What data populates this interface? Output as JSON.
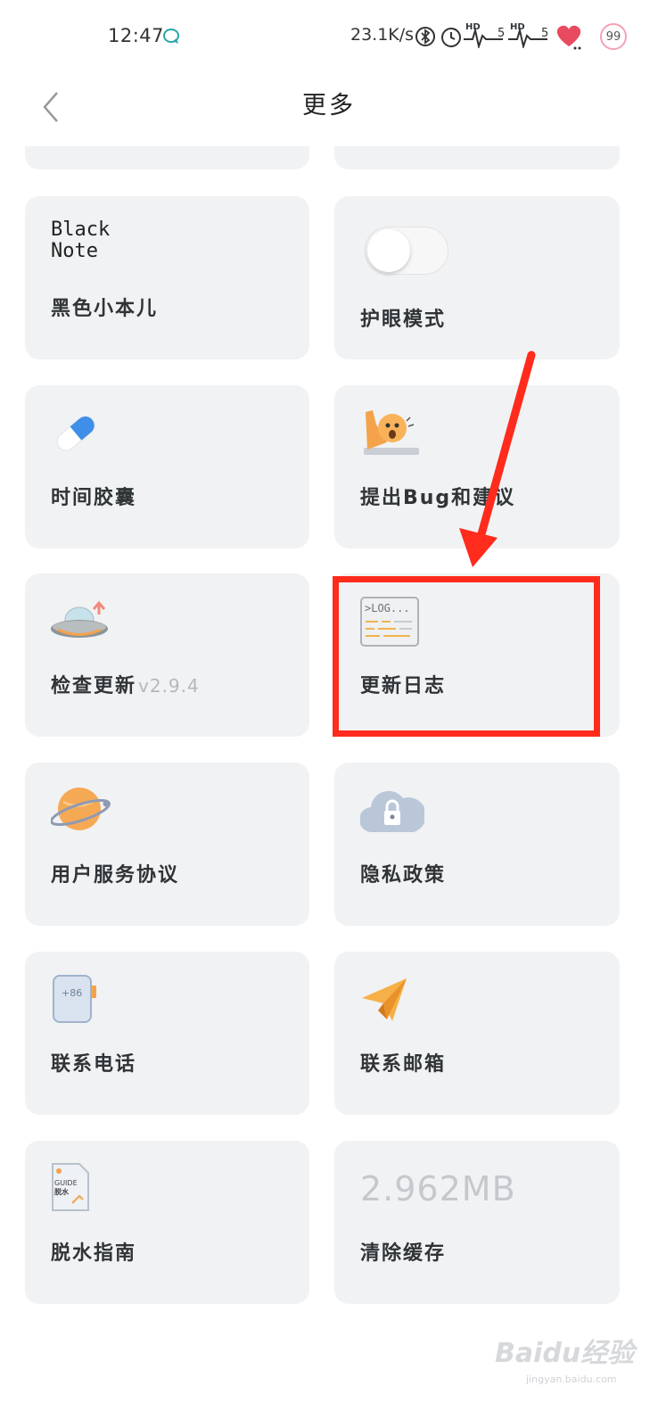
{
  "status_bar": {
    "time": "12:47",
    "net_speed": "23.1K/s",
    "battery": "99",
    "signal_label_1": "HD",
    "signal_label_2": "5",
    "signal_label_3": "HD",
    "signal_label_4": "5"
  },
  "header": {
    "title": "更多"
  },
  "cards": {
    "black_note": {
      "label": "黑色小本儿",
      "logo_text_1": "Black",
      "logo_text_2": "Note"
    },
    "eye_mode": {
      "label": "护眼模式",
      "toggle_on": false
    },
    "time_capsule": {
      "label": "时间胶囊"
    },
    "feedback": {
      "label": "提出Bug和建议"
    },
    "check_update": {
      "label": "检查更新",
      "version": "v2.9.4"
    },
    "changelog": {
      "label": "更新日志",
      "icon_text": ">LOG..."
    },
    "user_agreement": {
      "label": "用户服务协议"
    },
    "privacy": {
      "label": "隐私政策"
    },
    "phone": {
      "label": "联系电话",
      "icon_text": "+86"
    },
    "email": {
      "label": "联系邮箱"
    },
    "guide": {
      "label": "脱水指南",
      "icon_text_1": "GUIDE",
      "icon_text_2": "脱水"
    },
    "cache": {
      "label": "清除缓存",
      "size": "2.962MB"
    }
  },
  "watermark": {
    "text": "Baidu经验",
    "sub": "jingyan.baidu.com"
  },
  "colors": {
    "card_bg": "#f1f2f4",
    "highlight": "#ff2b1c",
    "text": "#2f3437"
  }
}
